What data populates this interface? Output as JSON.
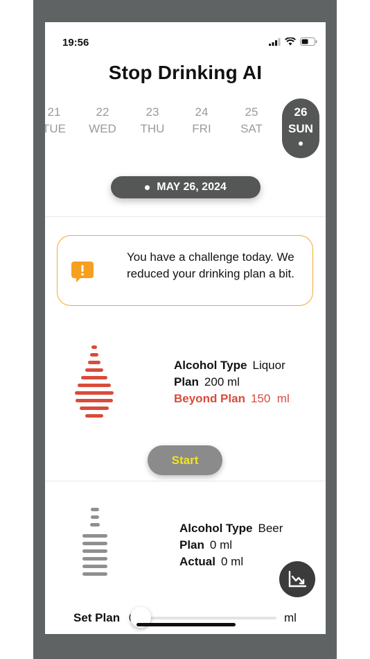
{
  "status_bar": {
    "time": "19:56"
  },
  "app": {
    "title": "Stop Drinking AI"
  },
  "days": [
    {
      "num": "21",
      "dow": "TUE",
      "selected": false
    },
    {
      "num": "22",
      "dow": "WED",
      "selected": false
    },
    {
      "num": "23",
      "dow": "THU",
      "selected": false
    },
    {
      "num": "24",
      "dow": "FRI",
      "selected": false
    },
    {
      "num": "25",
      "dow": "SAT",
      "selected": false
    },
    {
      "num": "26",
      "dow": "SUN",
      "selected": true
    }
  ],
  "date_pill": {
    "label": "MAY 26, 2024"
  },
  "notice": {
    "icon": "alert-bubble-icon",
    "text": "You have a challenge today. We reduced your drinking plan a bit.",
    "color": "#f0a930"
  },
  "entries": [
    {
      "icon": "liquor-drop-icon",
      "alcohol_type_label": "Alcohol Type",
      "alcohol_type": "Liquor",
      "plan_label": "Plan",
      "plan_value": "200",
      "plan_unit": "ml",
      "beyond_label": "Beyond Plan",
      "beyond_value": "150",
      "beyond_unit": "ml",
      "warn_color": "#d94b3a",
      "start_label": "Start"
    },
    {
      "icon": "beer-glass-icon",
      "alcohol_type_label": "Alcohol Type",
      "alcohol_type": "Beer",
      "plan_label": "Plan",
      "plan_value": "0",
      "plan_unit": "ml",
      "actual_label": "Actual",
      "actual_value": "0",
      "actual_unit": "ml"
    }
  ],
  "set_plan": {
    "label": "Set Plan",
    "value": "0",
    "unit": "ml",
    "slider_fraction": 0
  },
  "fab": {
    "icon": "chart-trend-icon"
  }
}
